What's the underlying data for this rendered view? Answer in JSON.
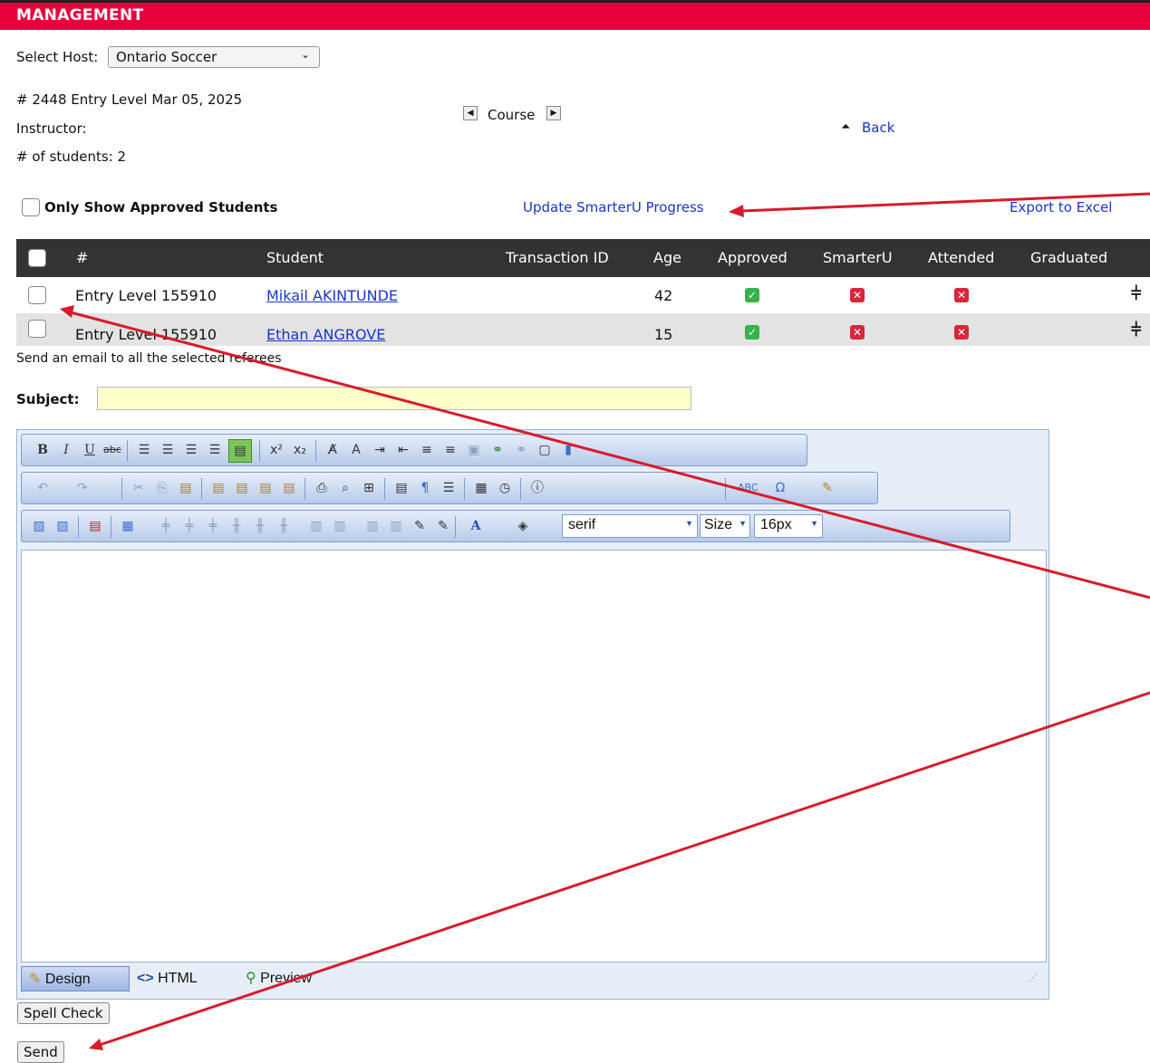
{
  "header": {
    "title": "MANAGEMENT"
  },
  "host": {
    "label": "Select Host:",
    "selected": "Ontario Soccer"
  },
  "course": {
    "info": "# 2448 Entry Level Mar 05, 2025",
    "instructor_label": "Instructor:",
    "students_count": "# of students: 2",
    "nav_label": "Course",
    "back_label": "Back"
  },
  "filters": {
    "approved_only_label": "Only Show Approved Students",
    "update_link": "Update SmarterU Progress",
    "export_link": "Export to Excel"
  },
  "table": {
    "columns": [
      "#",
      "Student",
      "Transaction ID",
      "Age",
      "Approved",
      "SmarterU",
      "Attended",
      "Graduated"
    ],
    "rows": [
      {
        "number": "Entry Level 155910",
        "student": "Mikail AKINTUNDE",
        "transaction_id": "",
        "age": "42",
        "approved": true,
        "smarteru": false,
        "attended": false
      },
      {
        "number": "Entry Level 155910",
        "student": "Ethan ANGROVE",
        "transaction_id": "",
        "age": "15",
        "approved": true,
        "smarteru": false,
        "attended": false
      }
    ]
  },
  "email": {
    "intro": "Send an email to all the selected referees",
    "subject_label": "Subject:",
    "subject_value": ""
  },
  "editor": {
    "font_name": "serif",
    "size_label": "Size",
    "font_size": "16px",
    "tabs": {
      "design": "Design",
      "html": "HTML",
      "preview": "Preview"
    }
  },
  "buttons": {
    "spell_check": "Spell Check",
    "send": "Send"
  },
  "colors": {
    "header_bg": "#e8003d",
    "link": "#1a35c9",
    "annotation_arrow": "#d81b2c",
    "subject_bg": "#ffffcc"
  }
}
